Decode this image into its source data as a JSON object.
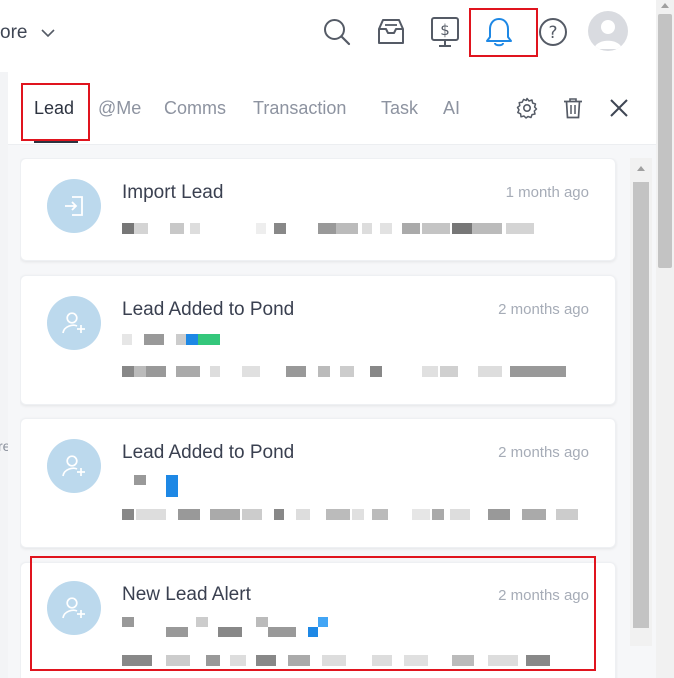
{
  "topbar": {
    "more_label": "ore",
    "icons": [
      "search-icon",
      "inbox-icon",
      "dollar-monitor-icon",
      "bell-icon",
      "help-icon"
    ]
  },
  "colors": {
    "accent": "#1e88e5",
    "highlight": "#e0141e",
    "icon_bg": "#bcd9ed"
  },
  "tabs": [
    {
      "label": "Lead",
      "active": true
    },
    {
      "label": "@Me"
    },
    {
      "label": "Comms"
    },
    {
      "label": "Transaction"
    },
    {
      "label": "Task"
    },
    {
      "label": "AI"
    }
  ],
  "tab_actions": [
    "settings-icon",
    "trash-icon",
    "close-icon"
  ],
  "notifications": [
    {
      "title": "Import Lead",
      "time": "1 month ago",
      "icon": "import-icon"
    },
    {
      "title": "Lead Added to Pond",
      "time": "2 months ago",
      "icon": "user-add-icon"
    },
    {
      "title": "Lead Added to Pond",
      "time": "2 months ago",
      "icon": "user-add-icon"
    },
    {
      "title": "New Lead Alert",
      "time": "2 months ago",
      "icon": "user-add-icon"
    }
  ]
}
